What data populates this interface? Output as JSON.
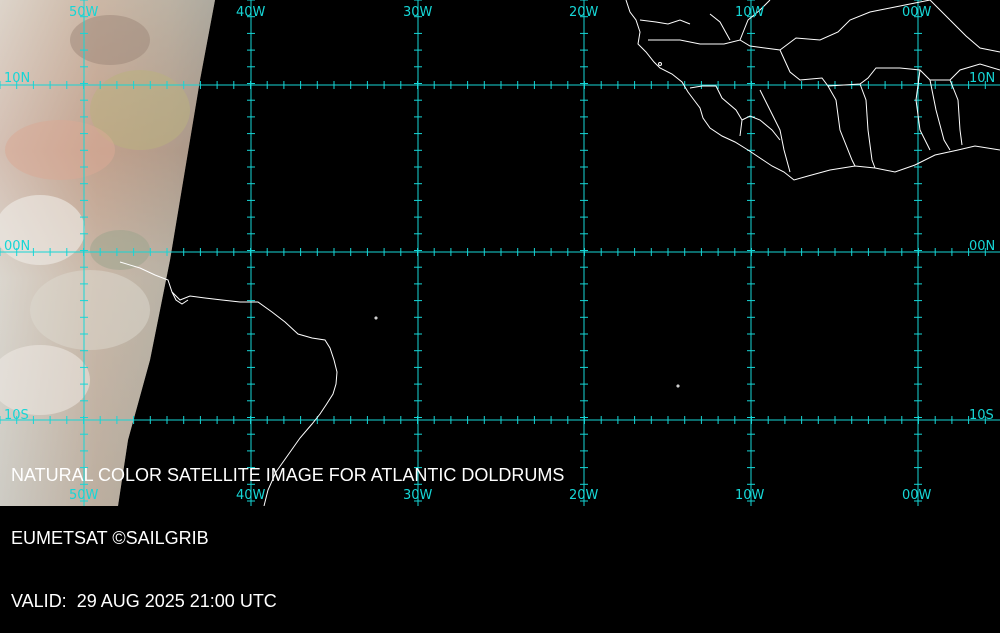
{
  "map": {
    "longitude_labels": [
      "50W",
      "40W",
      "30W",
      "20W",
      "10W",
      "00W"
    ],
    "latitude_labels": [
      "10N",
      "00N",
      "10S"
    ],
    "colors": {
      "grid": "#16d6d6",
      "coastline": "#ffffff",
      "ocean": "#000000",
      "cloud_warm": "#c8a890",
      "cloud_white": "#e8e2da"
    }
  },
  "caption": {
    "line1": "NATURAL COLOR SATELLITE IMAGE FOR ATLANTIC DOLDRUMS",
    "line2": "EUMETSAT ©SAILGRIB",
    "line3": "VALID:  29 AUG 2025 21:00 UTC"
  }
}
